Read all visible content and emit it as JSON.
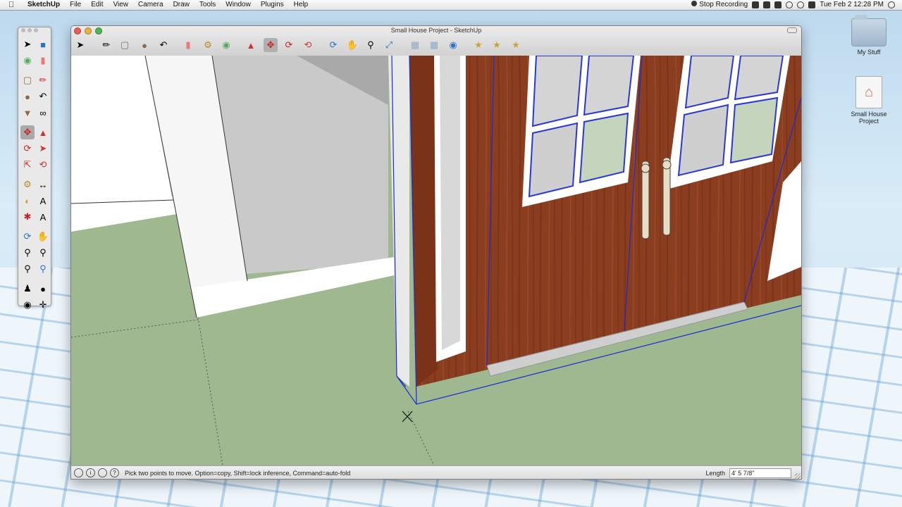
{
  "menubar": {
    "app": "SketchUp",
    "items": [
      "File",
      "Edit",
      "View",
      "Camera",
      "Draw",
      "Tools",
      "Window",
      "Plugins",
      "Help"
    ],
    "recording": "Stop Recording",
    "clock": "Tue Feb 2  12:28 PM"
  },
  "window": {
    "title": "Small House Project - SketchUp"
  },
  "statusbar": {
    "message": "Pick two points to move.  Option=copy, Shift=lock inference, Command=auto-fold",
    "measure_label": "Length",
    "measure_value": "4' 5 7/8\""
  },
  "desktop": {
    "icons": [
      {
        "label": "My Stuff",
        "icon": "folder-icon"
      },
      {
        "label": "Small House Project",
        "icon": "sketchup-file-icon"
      }
    ]
  },
  "palette_tools": [
    "select",
    "component",
    "paint",
    "eraser",
    "rectangle",
    "line",
    "circle",
    "arc",
    "polygon",
    "freehand",
    "move",
    "push-pull",
    "rotate",
    "follow-me",
    "scale",
    "offset",
    "tape-measure",
    "dimension",
    "protractor",
    "text",
    "axes",
    "3d-text",
    "orbit",
    "pan",
    "zoom",
    "zoom-window",
    "zoom-extents",
    "previous",
    "position-camera",
    "walk",
    "look-around",
    "section-plane"
  ],
  "toolbar_tools": [
    "select",
    "line",
    "rectangle",
    "circle",
    "arc",
    "eraser",
    "tape",
    "paint",
    "push-pull",
    "move",
    "rotate",
    "offset",
    "orbit",
    "pan",
    "zoom",
    "zoom-extents",
    "front-view",
    "iso-view",
    "top-view",
    "components",
    "materials",
    "styles",
    "layers"
  ],
  "colors": {
    "ground": "#9fb88f",
    "door_wood": "#8a3d1f",
    "selection": "#1c2bd6",
    "wall": "#ffffff",
    "wall_shadow": "#c9c9c9"
  }
}
